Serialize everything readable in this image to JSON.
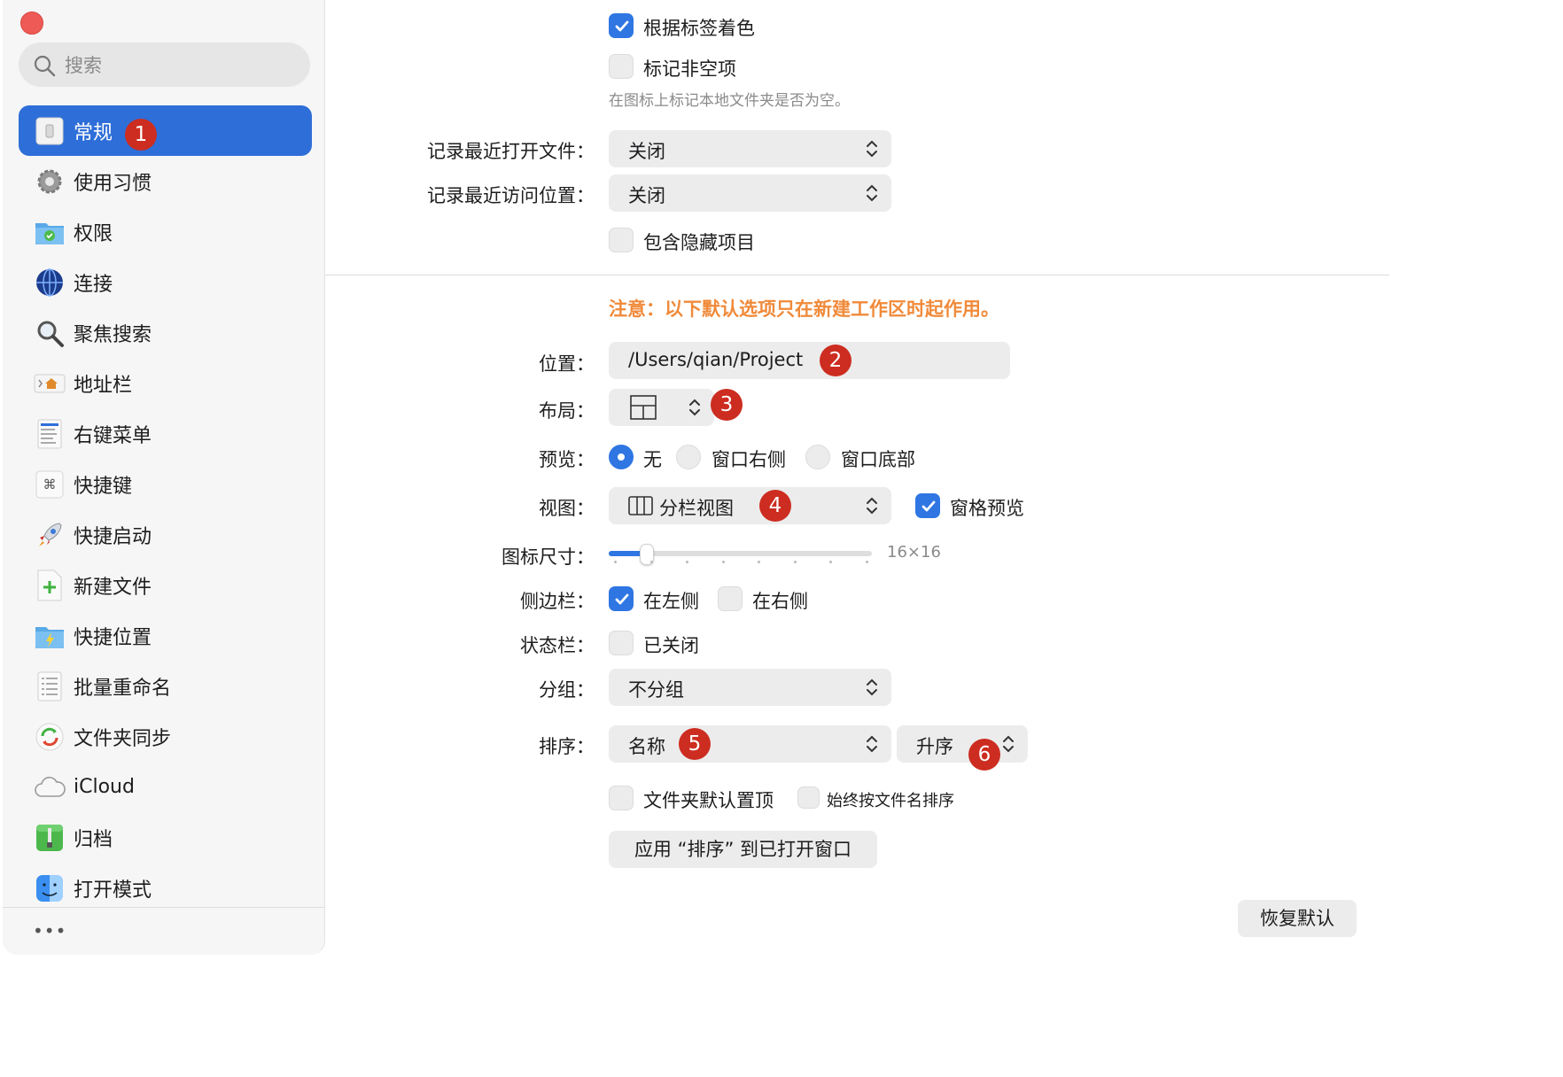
{
  "sidebar": {
    "search_placeholder": "搜索",
    "items": [
      {
        "label": "常规",
        "icon": "switch-icon",
        "active": true
      },
      {
        "label": "使用习惯",
        "icon": "gear-icon"
      },
      {
        "label": "权限",
        "icon": "folder-check-icon"
      },
      {
        "label": "连接",
        "icon": "globe-icon"
      },
      {
        "label": "聚焦搜索",
        "icon": "magnifier-icon"
      },
      {
        "label": "地址栏",
        "icon": "address-bar-icon"
      },
      {
        "label": "右键菜单",
        "icon": "context-menu-icon"
      },
      {
        "label": "快捷键",
        "icon": "command-key-icon"
      },
      {
        "label": "快捷启动",
        "icon": "rocket-icon"
      },
      {
        "label": "新建文件",
        "icon": "new-file-icon"
      },
      {
        "label": "快捷位置",
        "icon": "folder-bolt-icon"
      },
      {
        "label": "批量重命名",
        "icon": "list-icon"
      },
      {
        "label": "文件夹同步",
        "icon": "sync-icon"
      },
      {
        "label": "iCloud",
        "icon": "cloud-icon"
      },
      {
        "label": "归档",
        "icon": "archive-icon"
      },
      {
        "label": "打开模式",
        "icon": "finder-icon"
      }
    ],
    "more": "•••"
  },
  "badges": [
    "1",
    "2",
    "3",
    "4",
    "5",
    "6"
  ],
  "top": {
    "color_by_tag": "根据标签着色",
    "mark_non_empty": "标记非空项",
    "mark_non_empty_hint": "在图标上标记本地文件夹是否为空。",
    "recent_files_label": "记录最近打开文件：",
    "recent_files_value": "关闭",
    "recent_locations_label": "记录最近访问位置：",
    "recent_locations_value": "关闭",
    "include_hidden": "包含隐藏项目"
  },
  "note": "注意：以下默认选项只在新建工作区时起作用。",
  "location": {
    "label": "位置：",
    "value": "/Users/qian/Project"
  },
  "layout": {
    "label": "布局："
  },
  "preview": {
    "label": "预览：",
    "options": [
      "无",
      "窗口右侧",
      "窗口底部"
    ],
    "selected": 0
  },
  "view": {
    "label": "视图：",
    "value": "分栏视图",
    "pane_preview": "窗格预览"
  },
  "icon_size": {
    "label": "图标尺寸：",
    "value": "16×16",
    "level": 0.14
  },
  "sidebar_pos": {
    "label": "侧边栏：",
    "left": "在左侧",
    "right": "在右侧"
  },
  "status_bar": {
    "label": "状态栏：",
    "value": "已关闭"
  },
  "group": {
    "label": "分组：",
    "value": "不分组"
  },
  "sort": {
    "label": "排序：",
    "value": "名称",
    "order": "升序"
  },
  "folders_first": "文件夹默认置顶",
  "always_by_name": "始终按文件名排序",
  "apply_sort_button": "应用 “排序” 到已打开窗口",
  "restore_defaults_button": "恢复默认",
  "colors": {
    "accent": "#2f76e3",
    "badge": "#cc2d20",
    "note": "#f08a3a"
  }
}
